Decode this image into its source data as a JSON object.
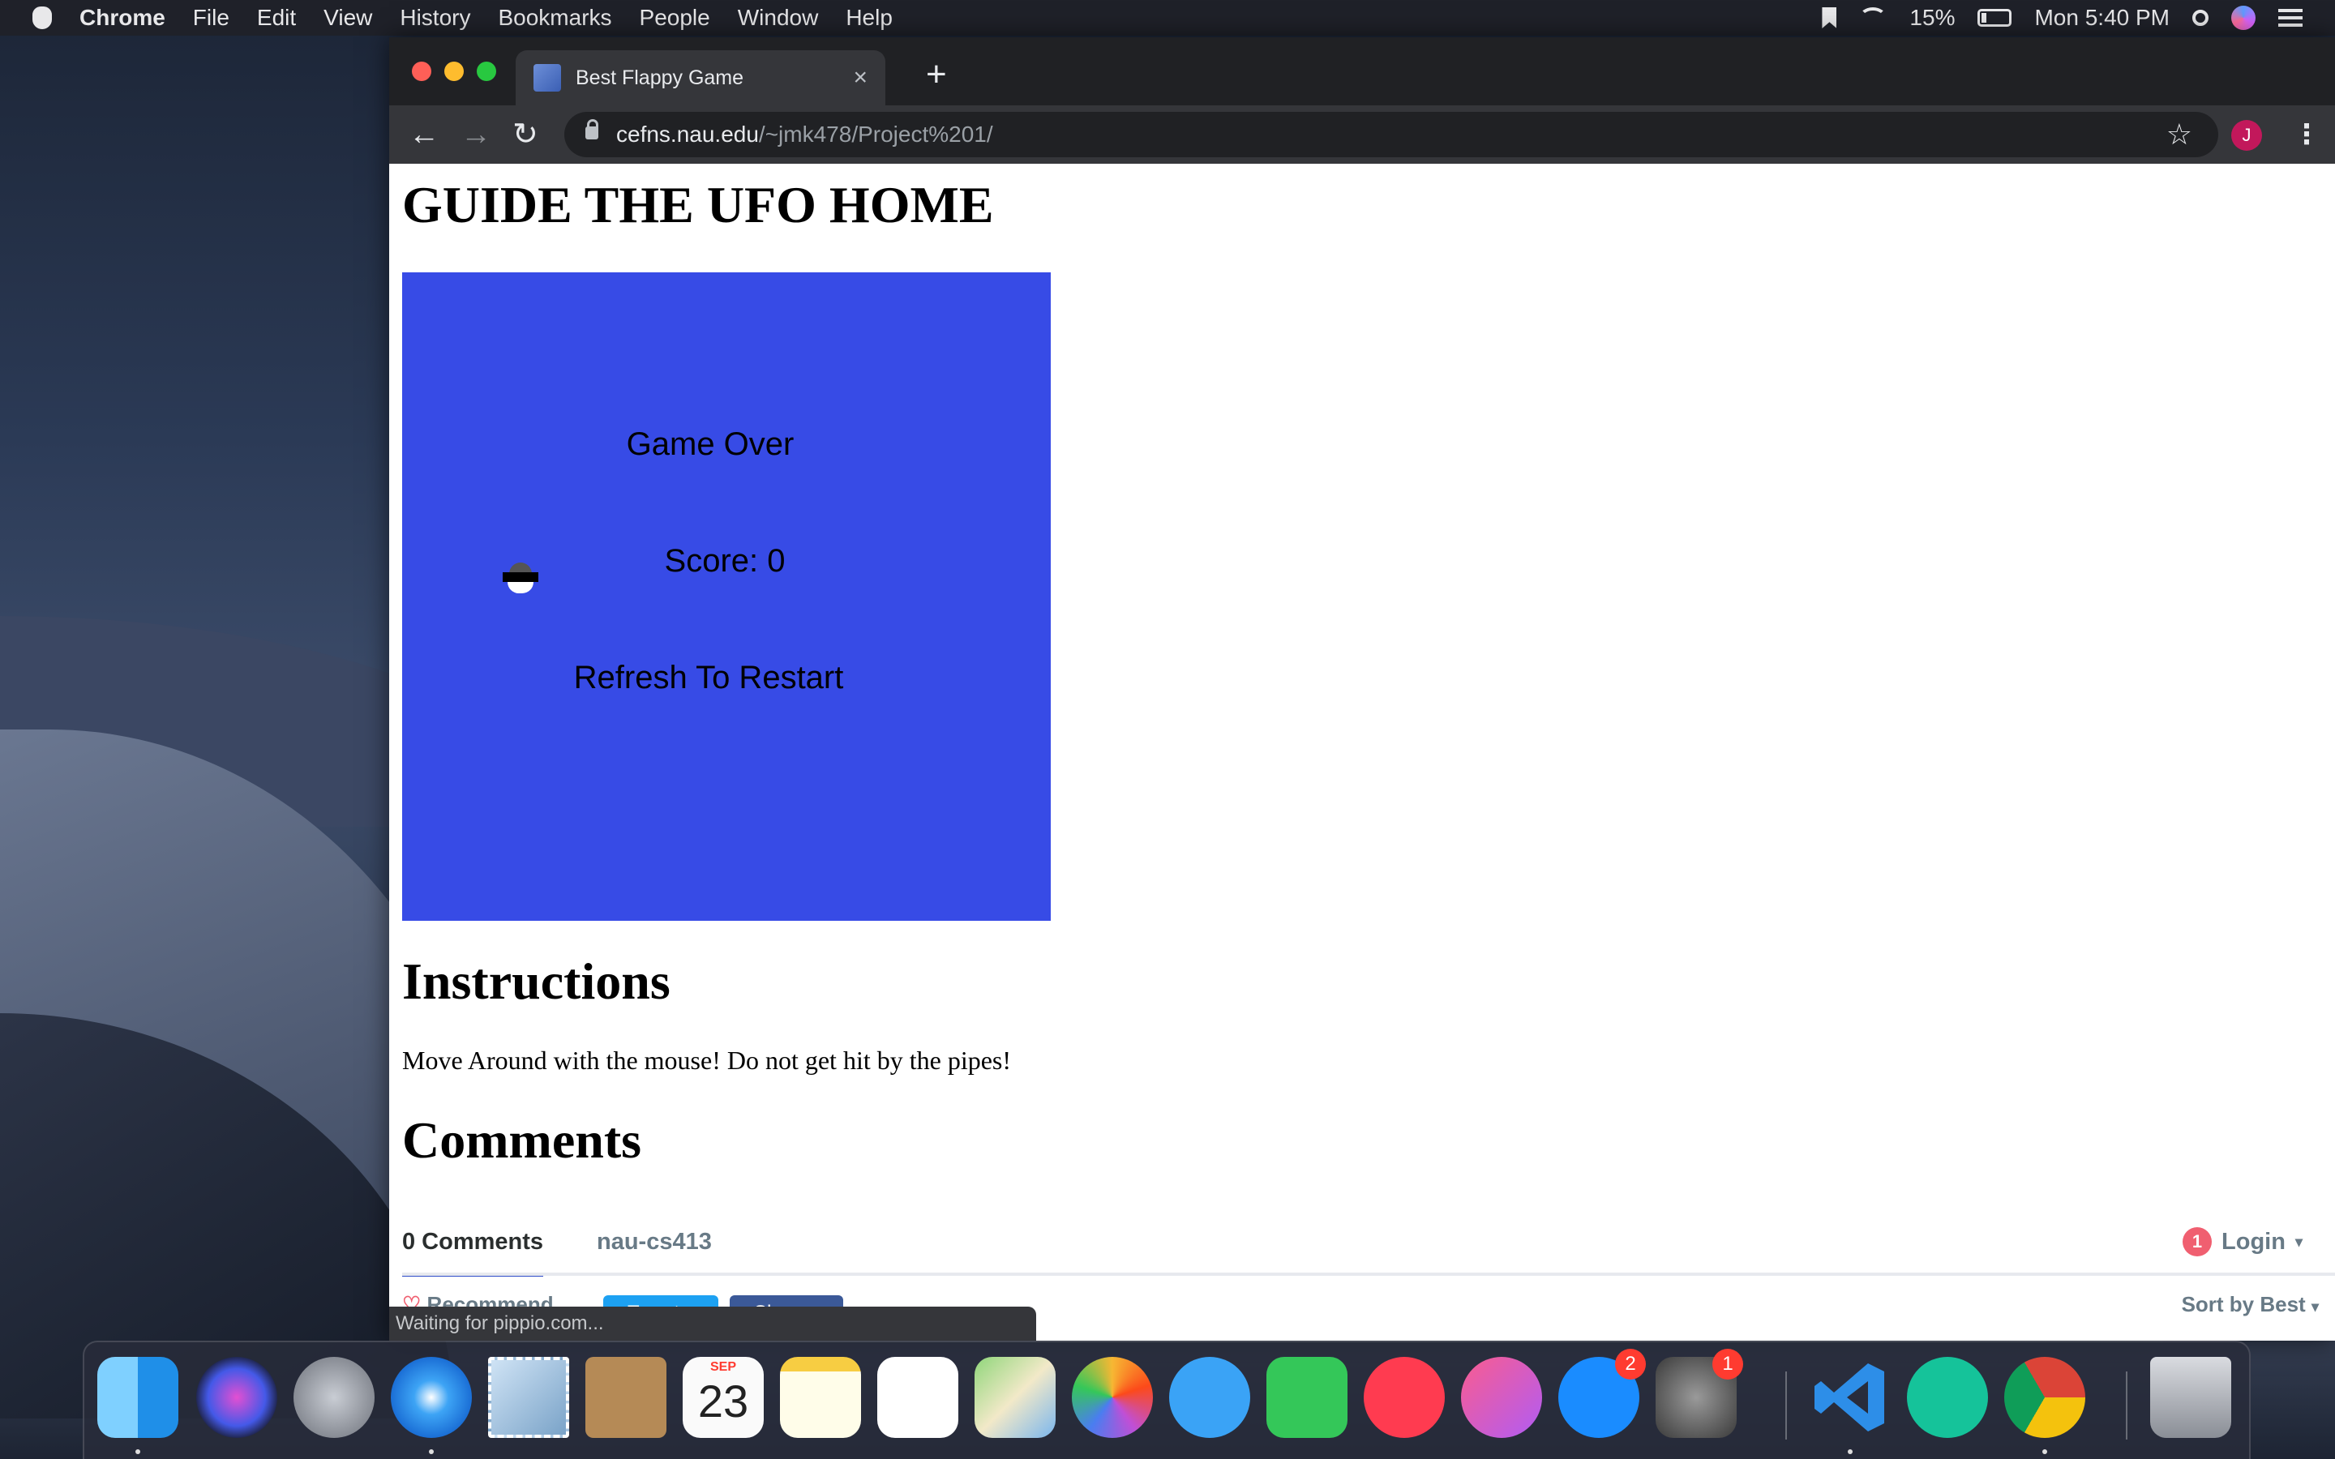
{
  "menubar": {
    "app_name": "Chrome",
    "menus": [
      "File",
      "Edit",
      "View",
      "History",
      "Bookmarks",
      "People",
      "Window",
      "Help"
    ],
    "battery": "15%",
    "clock": "Mon 5:40 PM"
  },
  "browser": {
    "tab_title": "Best Flappy Game",
    "tab_close": "×",
    "new_tab": "+",
    "back": "←",
    "forward": "→",
    "reload": "↻",
    "url_host": "cefns.nau.edu",
    "url_path": "/~jmk478/Project%201/",
    "star": "☆",
    "avatar_letter": "J",
    "menu": "⋮",
    "status_text": "Waiting for pippio.com..."
  },
  "page": {
    "title": "GUIDE THE UFO HOME",
    "game": {
      "game_over": "Game Over",
      "score": "Score: 0",
      "restart": "Refresh To Restart",
      "background_color": "#374be6"
    },
    "instructions_heading": "Instructions",
    "instructions_text": "Move Around with the mouse! Do not get hit by the pipes!",
    "comments_heading": "Comments"
  },
  "disqus": {
    "comment_count": "0 Comments",
    "forum": "nau-cs413",
    "login_badge": "1",
    "login": "Login",
    "sort": "Sort by Best",
    "recommend": "Recommend",
    "tweet": "Tweet",
    "share": "Share"
  },
  "dock": {
    "calendar_month": "SEP",
    "calendar_day": "23",
    "appstore_badge": "2",
    "prefs_badge": "1"
  }
}
